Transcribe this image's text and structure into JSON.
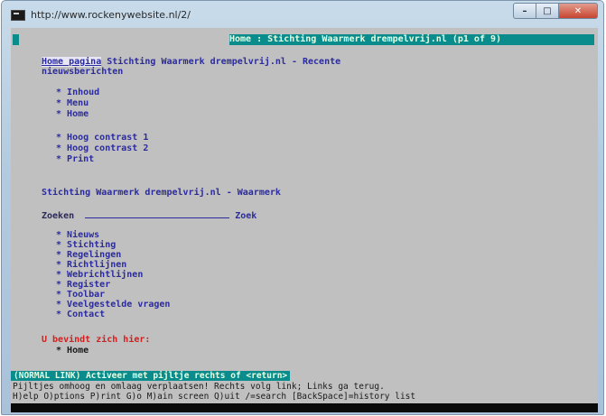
{
  "window": {
    "title": "http://www.rockenywebsite.nl/2/",
    "buttons": {
      "minimize": "–",
      "maximize": "□",
      "close": "✕"
    }
  },
  "terminal": {
    "topbar_text": "Home : Stichting Waarmerk drempelvrij.nl (p1 of 9)",
    "heading_link": "Home pagina",
    "heading_rest": " Stichting Waarmerk drempelvrij.nl - Recente",
    "heading_line2": "nieuwsberichten",
    "nav_group1": [
      "Inhoud",
      "Menu",
      "Home"
    ],
    "nav_group2": [
      "Hoog contrast 1",
      "Hoog contrast 2",
      "Print"
    ],
    "site_title": "Stichting Waarmerk drempelvrij.nl - Waarmerk",
    "search_label": "Zoeken",
    "search_button": "Zoek",
    "menu_items": [
      "Nieuws",
      "Stichting",
      "Regelingen",
      "Richtlijnen",
      "Webrichtlijnen",
      "Register",
      "Toolbar",
      "Veelgestelde vragen",
      "Contact"
    ],
    "location_text": "U bevindt zich hier:",
    "location_item": "Home",
    "command_text": "(NORMAL LINK) Activeer met pijltje rechts of <return>",
    "help_line1": "Pijltjes omhoog en omlaag verplaatsen! Rechts volg link; Links ga terug.",
    "help_line2": "H)elp O)ptions P)rint G)o M)ain screen Q)uit /=search [BackSpace]=history list"
  }
}
